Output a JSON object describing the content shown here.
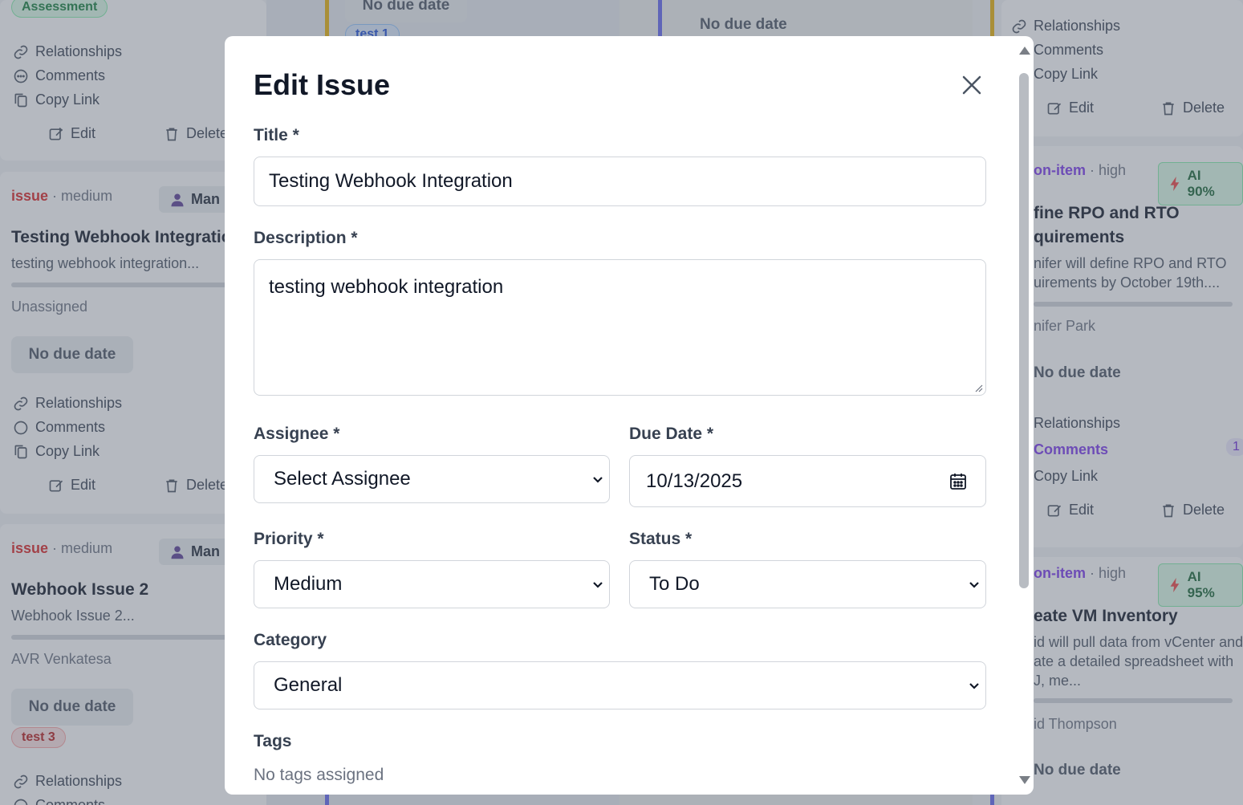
{
  "background": {
    "left_column": {
      "top_badge": "Assessment",
      "card_actions": {
        "relationships": "Relationships",
        "comments": "Comments",
        "copy_link": "Copy Link",
        "edit": "Edit",
        "delete": "Delete"
      },
      "cards": [
        {
          "type": "issue",
          "priority": "· medium",
          "assignee_chip": "Man",
          "title": "Testing Webhook Integratio",
          "desc": "testing webhook integration...",
          "owner": "Unassigned",
          "due": "No due date"
        },
        {
          "type": "issue",
          "priority": "· medium",
          "assignee_chip": "Man",
          "title": "Webhook Issue 2",
          "desc": "Webhook Issue 2...",
          "owner": "AVR Venkatesa",
          "due": "No due date",
          "tag": "test 3"
        }
      ]
    },
    "middle": {
      "due_1": "No due date",
      "due_2": "No due date",
      "tag": "test 1"
    },
    "right_column": {
      "card_actions": {
        "relationships": "Relationships",
        "comments": "Comments",
        "copy_link": "Copy Link",
        "edit": "Edit",
        "delete": "Delete"
      },
      "cards": [
        {
          "type": "on-item",
          "priority": "· high",
          "ai": "AI 90%",
          "title_1": "fine RPO and RTO",
          "title_2": "quirements",
          "desc_1": "nifer will define RPO and RTO",
          "desc_2": "uirements by October 19th....",
          "owner": "nifer Park",
          "due": "No due date",
          "comments_count": "1"
        },
        {
          "type": "on-item",
          "priority": "· high",
          "ai": "AI 95%",
          "title_1": "eate VM Inventory",
          "desc_1": "id will pull data from vCenter and",
          "desc_2": "ate a detailed spreadsheet with",
          "desc_3": "J, me...",
          "owner": "id Thompson",
          "due": "No due date"
        }
      ]
    }
  },
  "modal": {
    "title": "Edit Issue",
    "fields": {
      "title": {
        "label": "Title *",
        "value": "Testing Webhook Integration"
      },
      "description": {
        "label": "Description *",
        "value": "testing webhook integration"
      },
      "assignee": {
        "label": "Assignee *",
        "value": "Select Assignee"
      },
      "due_date": {
        "label": "Due Date *",
        "value": "10/13/2025"
      },
      "priority": {
        "label": "Priority *",
        "value": "Medium"
      },
      "status": {
        "label": "Status *",
        "value": "To Do"
      },
      "category": {
        "label": "Category",
        "value": "General"
      },
      "tags": {
        "label": "Tags",
        "empty_text": "No tags assigned"
      }
    }
  },
  "icons": [
    "close-icon",
    "chevron-down-icon",
    "calendar-icon",
    "link-icon",
    "comment-icon",
    "copy-icon",
    "edit-icon",
    "trash-icon",
    "user-icon",
    "bolt-icon"
  ]
}
